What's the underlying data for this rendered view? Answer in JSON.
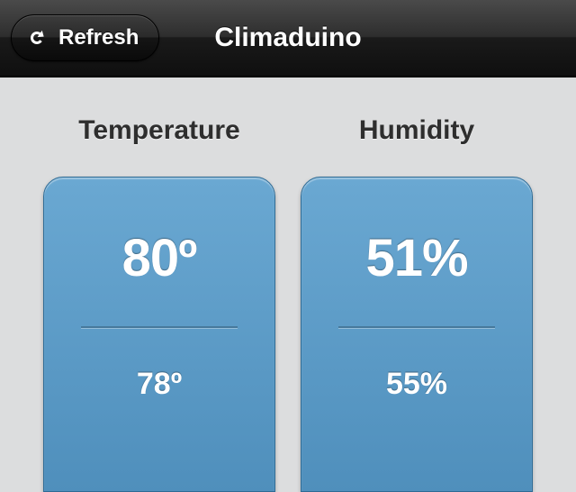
{
  "header": {
    "title": "Climaduino",
    "refresh_label": "Refresh"
  },
  "temperature": {
    "label": "Temperature",
    "current": "80º",
    "target": "78º"
  },
  "humidity": {
    "label": "Humidity",
    "current": "51%",
    "target": "55%"
  }
}
